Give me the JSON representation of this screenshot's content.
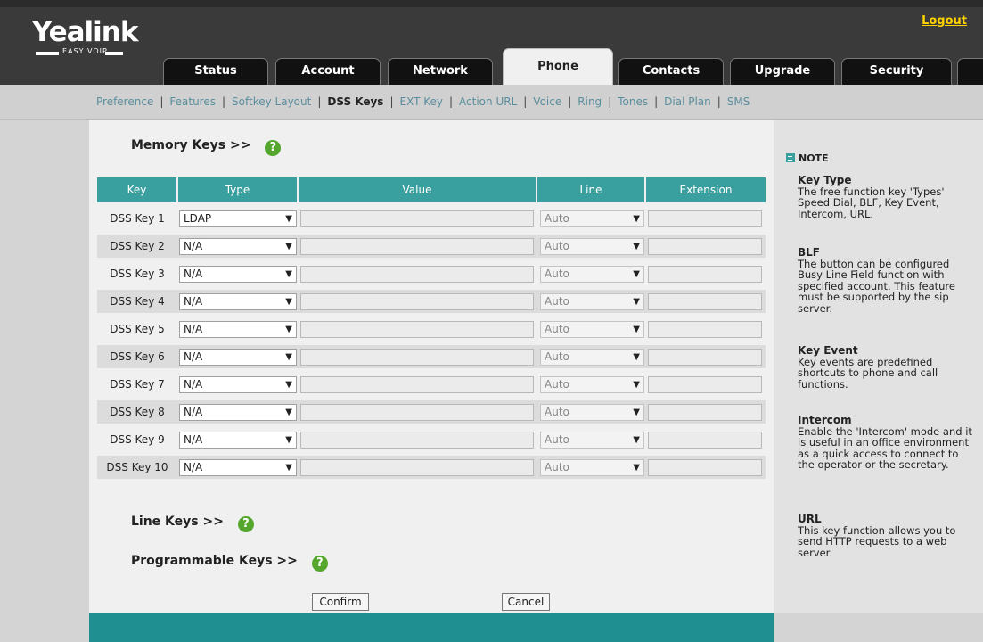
{
  "header": {
    "logo_text": "Yealink",
    "logo_sub": "EASY VOIP",
    "logout_label": "Logout",
    "tabs": [
      {
        "label": "Status"
      },
      {
        "label": "Account"
      },
      {
        "label": "Network"
      },
      {
        "label": "Phone",
        "active": true
      },
      {
        "label": "Contacts"
      },
      {
        "label": "Upgrade"
      },
      {
        "label": "Security"
      }
    ]
  },
  "subnav": {
    "items": [
      {
        "label": "Preference"
      },
      {
        "label": "Features"
      },
      {
        "label": "Softkey Layout"
      },
      {
        "label": "DSS Keys",
        "active": true
      },
      {
        "label": "EXT Key"
      },
      {
        "label": "Action URL"
      },
      {
        "label": "Voice"
      },
      {
        "label": "Ring"
      },
      {
        "label": "Tones"
      },
      {
        "label": "Dial Plan"
      },
      {
        "label": "SMS"
      }
    ],
    "separator": "|"
  },
  "main": {
    "memory_keys_title": "Memory Keys >>",
    "line_keys_title": "Line Keys >>",
    "programmable_keys_title": "Programmable Keys >>",
    "help_glyph": "?",
    "table": {
      "headers": {
        "key": "Key",
        "type": "Type",
        "value": "Value",
        "line": "Line",
        "extension": "Extension"
      },
      "rows": [
        {
          "key": "DSS Key 1",
          "type": "LDAP",
          "value": "",
          "line": "Auto",
          "extension": ""
        },
        {
          "key": "DSS Key 2",
          "type": "N/A",
          "value": "",
          "line": "Auto",
          "extension": ""
        },
        {
          "key": "DSS Key 3",
          "type": "N/A",
          "value": "",
          "line": "Auto",
          "extension": ""
        },
        {
          "key": "DSS Key 4",
          "type": "N/A",
          "value": "",
          "line": "Auto",
          "extension": ""
        },
        {
          "key": "DSS Key 5",
          "type": "N/A",
          "value": "",
          "line": "Auto",
          "extension": ""
        },
        {
          "key": "DSS Key 6",
          "type": "N/A",
          "value": "",
          "line": "Auto",
          "extension": ""
        },
        {
          "key": "DSS Key 7",
          "type": "N/A",
          "value": "",
          "line": "Auto",
          "extension": ""
        },
        {
          "key": "DSS Key 8",
          "type": "N/A",
          "value": "",
          "line": "Auto",
          "extension": ""
        },
        {
          "key": "DSS Key 9",
          "type": "N/A",
          "value": "",
          "line": "Auto",
          "extension": ""
        },
        {
          "key": "DSS Key 10",
          "type": "N/A",
          "value": "",
          "line": "Auto",
          "extension": ""
        }
      ]
    },
    "confirm_label": "Confirm",
    "cancel_label": "Cancel"
  },
  "note": {
    "title": "NOTE",
    "sections": [
      {
        "title": "Key Type",
        "body": "The free function key 'Types' Speed Dial, BLF, Key Event, Intercom, URL."
      },
      {
        "title": "BLF",
        "body": "The button can be configured Busy Line Field function with specified account. This feature must be supported by the sip server."
      },
      {
        "title": "Key Event",
        "body": "Key events are predefined shortcuts to phone and call functions."
      },
      {
        "title": "Intercom",
        "body": "Enable the 'Intercom' mode and it is useful in an office environment as a quick access to connect to the operator or the secretary."
      },
      {
        "title": "URL",
        "body": "This key function allows you to send HTTP requests to a web server."
      }
    ]
  },
  "colors": {
    "header_bg": "#3a3a3a",
    "accent_teal": "#3aa09f",
    "logout_yellow": "#ffd200",
    "help_green": "#54a72c",
    "subnav_link": "#5a8e9e"
  }
}
